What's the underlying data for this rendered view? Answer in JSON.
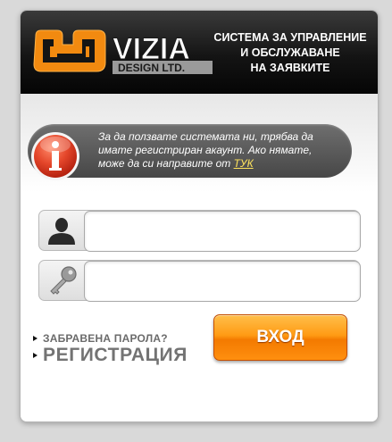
{
  "header": {
    "logo_word": "VIZIA",
    "logo_subtitle": "DESIGN LTD.",
    "title": "СИСТЕМА ЗА УПРАВЛЕНИЕ\nИ ОБСЛУЖАВАНЕ\nНА ЗАЯВКИТЕ"
  },
  "notice": {
    "icon": "info-icon",
    "text": "За да ползвате системата ни, трябва да имате регистриран акаунт. Ако нямате, може да си направите от ",
    "link_label": "ТУК"
  },
  "form": {
    "username": {
      "icon": "user-icon",
      "value": "",
      "placeholder": ""
    },
    "password": {
      "icon": "key-icon",
      "value": "",
      "placeholder": ""
    },
    "login_label": "ВХОД"
  },
  "links": {
    "forgot_password": "ЗАБРАВЕНА ПАРОЛА?",
    "register": "РЕГИСТРАЦИЯ"
  },
  "colors": {
    "accent_orange": "#ff9b14",
    "header_dark": "#141414",
    "info_red": "#e4462a",
    "link_yellow": "#ffe45c"
  }
}
